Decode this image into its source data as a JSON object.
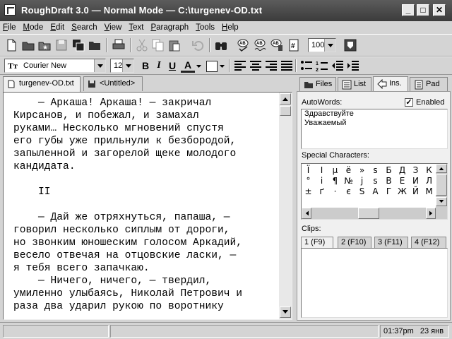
{
  "window": {
    "title": "RoughDraft 3.0  —  Normal Mode  —  C:\\turgenev-OD.txt",
    "minimize": "_",
    "maximize": "□",
    "close": "✕"
  },
  "menu": [
    "File",
    "Mode",
    "Edit",
    "Search",
    "View",
    "Text",
    "Paragraph",
    "Tools",
    "Help"
  ],
  "toolbar": {
    "zoom_value": "100",
    "icons": [
      "new-doc-icon",
      "open-folder-icon",
      "open-favorite-icon",
      "save-icon",
      "save-all-icon",
      "folder-icon",
      "print-icon",
      "cut-icon",
      "copy-icon",
      "paste-icon",
      "undo-icon",
      "find-icon",
      "spellcheck-icon",
      "spellcheck-all-icon",
      "thesaurus-icon",
      "word-count-icon",
      "go-to-icon"
    ]
  },
  "format": {
    "font_name": "Courier New",
    "font_size": "12",
    "bold": "B",
    "italic": "I",
    "underline": "U",
    "font_color": "A"
  },
  "doc_tabs": [
    {
      "label": "turgenev-OD.txt",
      "active": true
    },
    {
      "label": "<Untitled>",
      "active": false
    }
  ],
  "editor": {
    "text": "    — Аркаша! Аркаша! — закричал\nКирсанов, и побежал, и замахал\nруками… Несколько мгновений спустя\nего губы уже прильнули к безбородой,\nзапыленной и загорелой щеке молодого\nкандидата.\n\n    II\n\n    — Дай же отряхнуться, папаша, —\nговорил несколько сиплым от дороги,\nно звонким юношеским голосом Аркадий,\nвесело отвечая на отцовские ласки, —\nя тебя всего запачкаю.\n    — Ничего, ничего, — твердил,\nумиленно улыбаясь, Николай Петрович и\nраза два ударил рукою по воротнику"
  },
  "panel": {
    "tabs": [
      {
        "label": "Files",
        "active": false
      },
      {
        "label": "List",
        "active": false
      },
      {
        "label": "Ins.",
        "active": true
      },
      {
        "label": "Pad",
        "active": false
      }
    ],
    "autowords_label": "AutoWords:",
    "enabled_label": "Enabled",
    "enabled_checked": "✓",
    "autowords": [
      "Здравствуйте",
      "Уважаемый"
    ],
    "special_label": "Special Characters:",
    "special_chars": [
      "Ї",
      "І",
      "µ",
      "ё",
      "»",
      "s",
      "Б",
      "Д",
      "З",
      "К",
      "°",
      "і",
      "¶",
      "№",
      "ј",
      "ѕ",
      "В",
      "Е",
      "И",
      "Л",
      "±",
      "ґ",
      "·",
      "є",
      "Ѕ",
      "А",
      "Г",
      "Ж",
      "Й",
      "М"
    ],
    "clips_label": "Clips:",
    "clip_tabs": [
      "1 (F9)",
      "2 (F10)",
      "3 (F11)",
      "4 (F12)"
    ]
  },
  "status": {
    "time": "01:37pm",
    "date": "23 янв"
  }
}
